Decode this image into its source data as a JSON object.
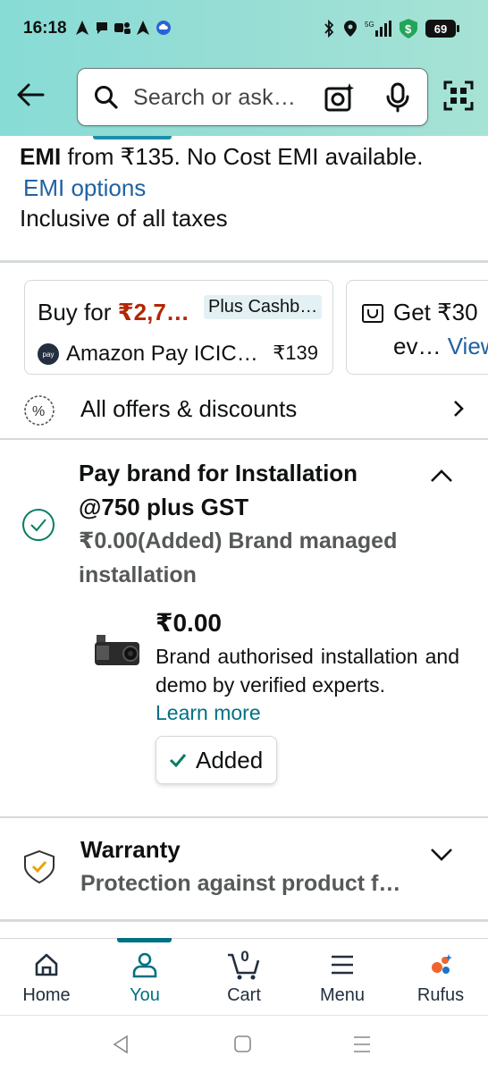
{
  "status_bar": {
    "time": "16:18",
    "battery": "69",
    "network": "5G"
  },
  "header": {
    "search_placeholder": "Search or ask…",
    "icons": [
      "back-arrow-icon",
      "search-icon",
      "camera-lens-icon",
      "microphone-icon",
      "qr-scan-icon"
    ]
  },
  "emi": {
    "prefix": "EMI",
    "text": " from ₹135. No Cost EMI available.",
    "options_link": "EMI options",
    "taxes": "Inclusive of all taxes"
  },
  "offers": {
    "card1": {
      "buy_for": "Buy for ",
      "price": "₹2,7…",
      "cashback": "Plus Cashb…",
      "pay_logo": "pay",
      "pay_name": "Amazon Pay ICIC…",
      "amount": "₹139"
    },
    "card2": {
      "get": "Get ₹30",
      "ev": "ev… ",
      "view": "View"
    },
    "all_offers": "All offers & discounts"
  },
  "installation": {
    "title": "Pay brand for Installation @750 plus GST",
    "subtitle": "₹0.00(Added) Brand managed installation",
    "price": "₹0.00",
    "description": "Brand authorised installation and demo by verified experts.",
    "learn_more": "Learn more",
    "added_label": "Added"
  },
  "warranty": {
    "title": "Warranty",
    "subtitle": "Protection against product f…"
  },
  "bottom_nav": {
    "items": [
      {
        "label": "Home",
        "icon": "home-icon"
      },
      {
        "label": "You",
        "icon": "person-icon",
        "active": true
      },
      {
        "label": "Cart",
        "icon": "cart-icon",
        "count": "0"
      },
      {
        "label": "Menu",
        "icon": "menu-icon"
      },
      {
        "label": "Rufus",
        "icon": "rufus-icon"
      }
    ]
  },
  "colors": {
    "header_teal": "#97ddd5",
    "link_blue": "#2162a1",
    "link_teal": "#007185",
    "price_red": "#b12704",
    "check_green": "#067d62"
  }
}
